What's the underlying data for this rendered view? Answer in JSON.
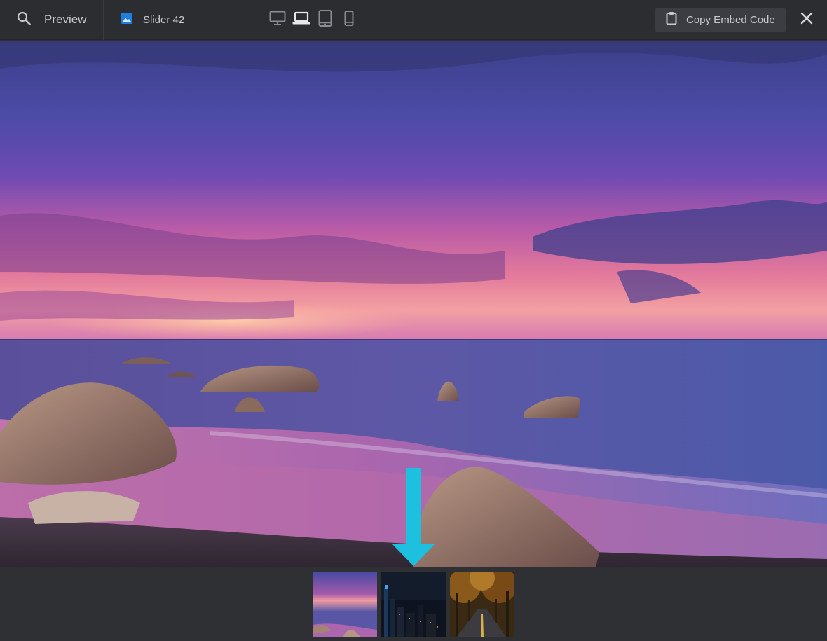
{
  "header": {
    "preview_label": "Preview",
    "slider_name": "Slider 42",
    "copy_embed_label": "Copy Embed Code",
    "devices": [
      {
        "name": "desktop",
        "active": false
      },
      {
        "name": "laptop",
        "active": true
      },
      {
        "name": "tablet",
        "active": false
      },
      {
        "name": "mobile",
        "active": false
      }
    ]
  },
  "colors": {
    "accent": "#1f7de0",
    "arrow": "#1ec0e0",
    "toolbar_bg": "#2c2d31",
    "icon_inactive": "#8c8d92",
    "icon_active": "#e8e8ea"
  },
  "slider": {
    "active_slide": 1,
    "slides": [
      {
        "subject": "sunset-seascape"
      },
      {
        "subject": "city-at-night"
      },
      {
        "subject": "autumn-forest-road"
      }
    ]
  }
}
